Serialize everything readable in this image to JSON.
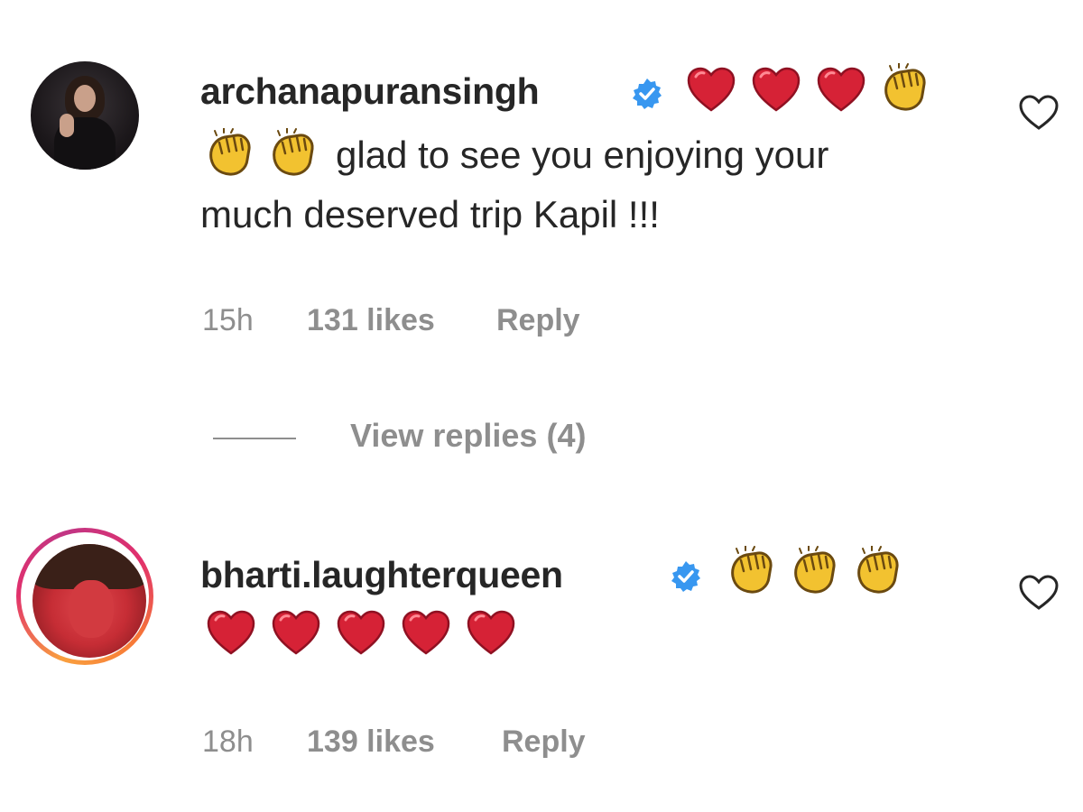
{
  "comments": [
    {
      "username": "archanapuransingh",
      "verified": true,
      "text_line1": "glad to see you enjoying your",
      "text_line2": "much deserved trip Kapil !!!",
      "time": "15h",
      "likes": "131 likes",
      "reply_label": "Reply",
      "view_replies": "View replies (4)"
    },
    {
      "username": "bharti.laughterqueen",
      "verified": true,
      "time": "18h",
      "likes": "139 likes",
      "reply_label": "Reply"
    }
  ],
  "icons": {
    "verified": "verified-badge-icon",
    "heart_emoji": "red-heart-emoji",
    "clap_emoji": "clapping-hands-emoji",
    "like": "heart-outline-icon"
  },
  "colors": {
    "text": "#262626",
    "muted": "#8e8e8e",
    "verified": "#3897f0",
    "heart": "#d62236",
    "clap": "#f2c230"
  }
}
